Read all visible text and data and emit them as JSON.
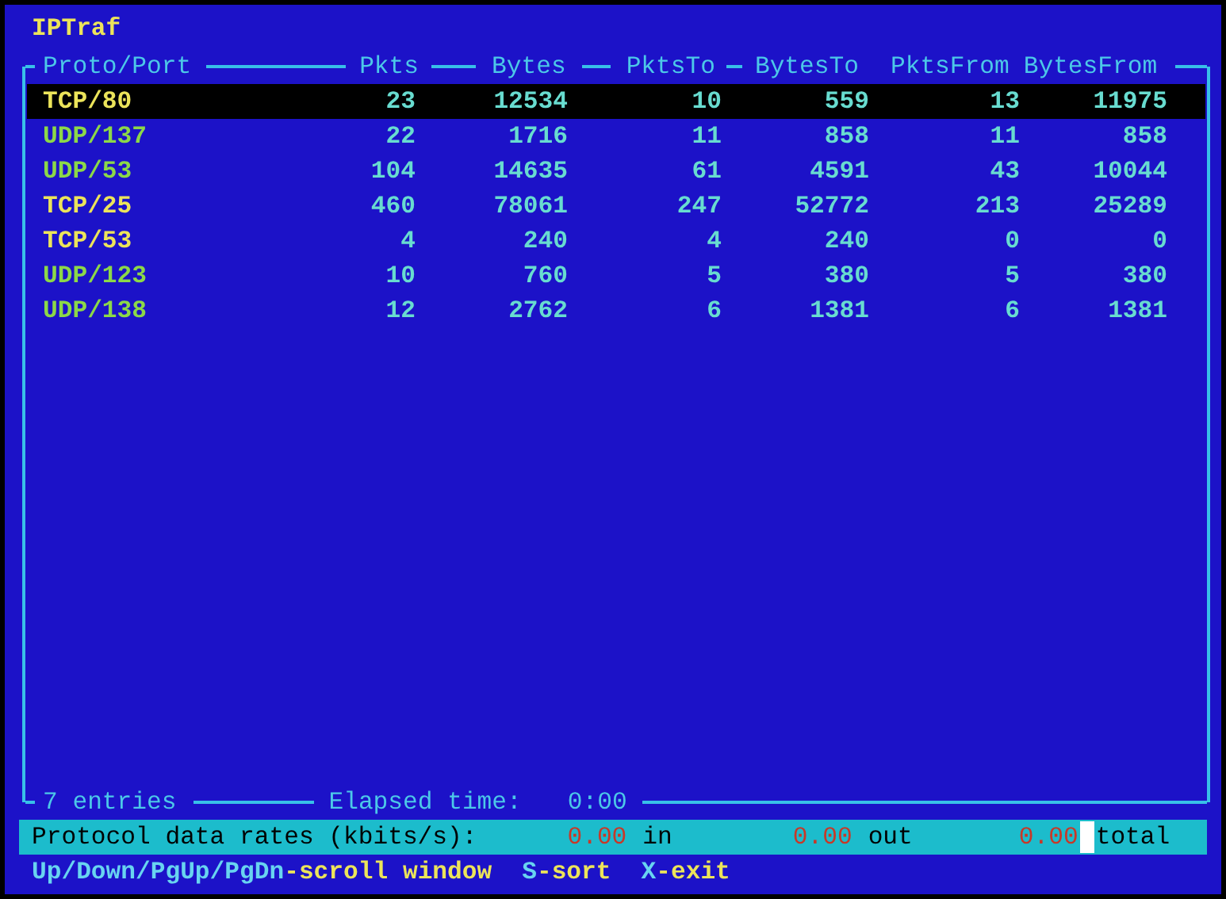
{
  "title": "IPTraf",
  "columns": [
    "Proto/Port",
    "Pkts",
    "Bytes",
    "PktsTo",
    "BytesTo",
    "PktsFrom",
    "BytesFrom"
  ],
  "rows": [
    {
      "kind": "tcp",
      "selected": true,
      "cells": [
        "TCP/80",
        "23",
        "12534",
        "10",
        "559",
        "13",
        "11975"
      ]
    },
    {
      "kind": "udp",
      "selected": false,
      "cells": [
        "UDP/137",
        "22",
        "1716",
        "11",
        "858",
        "11",
        "858"
      ]
    },
    {
      "kind": "udp",
      "selected": false,
      "cells": [
        "UDP/53",
        "104",
        "14635",
        "61",
        "4591",
        "43",
        "10044"
      ]
    },
    {
      "kind": "tcp",
      "selected": false,
      "cells": [
        "TCP/25",
        "460",
        "78061",
        "247",
        "52772",
        "213",
        "25289"
      ]
    },
    {
      "kind": "tcp",
      "selected": false,
      "cells": [
        "TCP/53",
        "4",
        "240",
        "4",
        "240",
        "0",
        "0"
      ]
    },
    {
      "kind": "udp",
      "selected": false,
      "cells": [
        "UDP/123",
        "10",
        "760",
        "5",
        "380",
        "5",
        "380"
      ]
    },
    {
      "kind": "udp",
      "selected": false,
      "cells": [
        "UDP/138",
        "12",
        "2762",
        "6",
        "1381",
        "6",
        "1381"
      ]
    }
  ],
  "footer": {
    "entries": "7 entries",
    "elapsed_label": "Elapsed time:",
    "elapsed": "0:00"
  },
  "rates": {
    "label": "Protocol data rates (kbits/s):",
    "items": [
      {
        "value": "0.00",
        "unit": "in"
      },
      {
        "value": "0.00",
        "unit": "out"
      },
      {
        "value": "0.00",
        "unit": "total"
      }
    ]
  },
  "hints": [
    {
      "key": "Up/Down/PgUp/PgDn",
      "action": "-scroll window"
    },
    {
      "key": "S",
      "action": "-sort"
    },
    {
      "key": "X",
      "action": "-exit"
    }
  ]
}
